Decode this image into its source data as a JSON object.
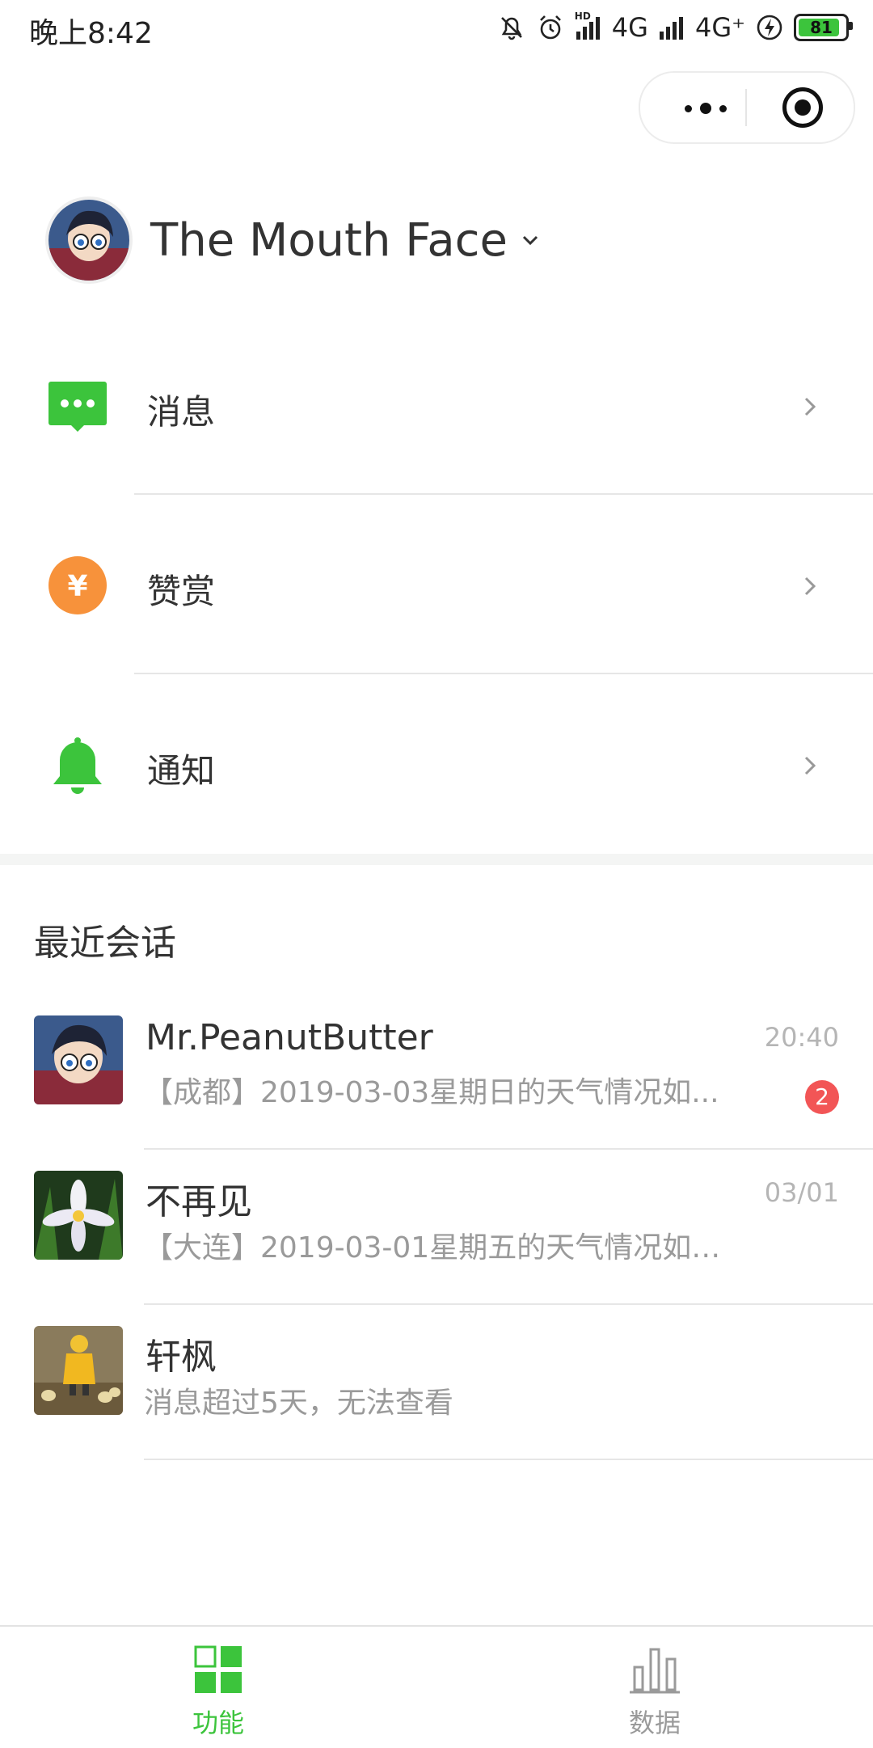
{
  "status_bar": {
    "time": "晚上8:42",
    "network_1": "4G",
    "network_2": "4G⁺",
    "battery": "81",
    "hd_label": "HD"
  },
  "account": {
    "name": "The Mouth Face"
  },
  "menu": [
    {
      "label": "消息",
      "icon": "message-icon",
      "color": "#3cc43c"
    },
    {
      "label": "赞赏",
      "icon": "yuan-coin-icon",
      "color": "#f7923b"
    },
    {
      "label": "通知",
      "icon": "bell-icon",
      "color": "#3cc43c"
    }
  ],
  "recent": {
    "title": "最近会话",
    "conversations": [
      {
        "name": "Mr.PeanutButter",
        "preview": "【成都】2019-03-03星期日的天气情况如...",
        "time": "20:40",
        "unread": "2"
      },
      {
        "name": "不再见",
        "preview": "【大连】2019-03-01星期五的天气情况如下：",
        "time": "03/01"
      },
      {
        "name": "轩枫",
        "preview": "消息超过5天，无法查看",
        "time": ""
      }
    ]
  },
  "tabbar": {
    "tabs": [
      {
        "label": "功能",
        "active": true,
        "icon": "grid-icon"
      },
      {
        "label": "数据",
        "active": false,
        "icon": "bar-chart-icon"
      }
    ]
  },
  "colors": {
    "accent_green": "#3cc43c",
    "orange": "#f7923b",
    "badge_red": "#f25556",
    "inactive_gray": "#9a9a9a"
  }
}
